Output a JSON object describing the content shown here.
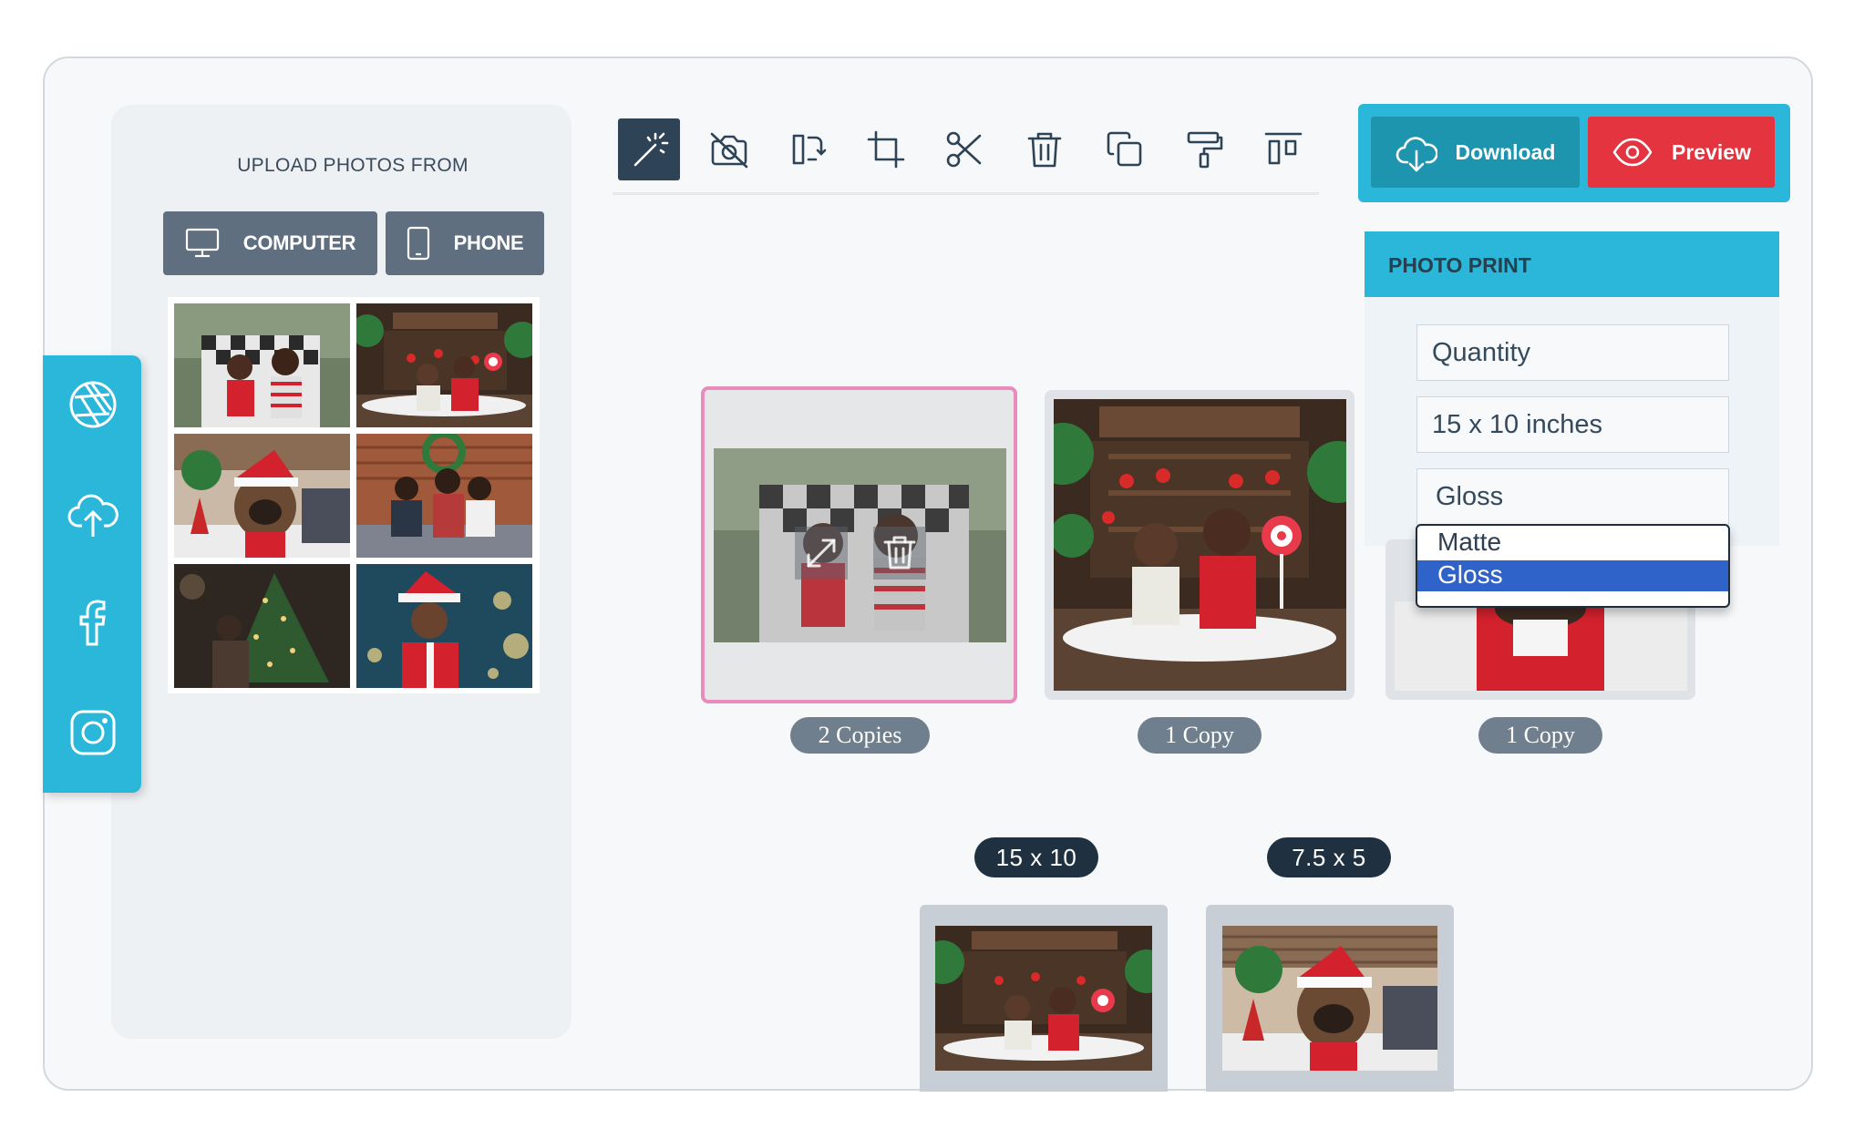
{
  "upload": {
    "title": "UPLOAD PHOTOS FROM",
    "computer_label": "COMPUTER",
    "phone_label": "PHONE"
  },
  "social": {
    "items": [
      "aperture-icon",
      "cloud-upload-icon",
      "facebook-icon",
      "instagram-icon"
    ]
  },
  "toolbar": {
    "tools": [
      "magic-wand-icon",
      "no-camera-icon",
      "rotate-icon",
      "crop-icon",
      "cut-icon",
      "trash-icon",
      "duplicate-icon",
      "paint-roller-icon",
      "layout-icon"
    ]
  },
  "actions": {
    "download_label": "Download",
    "preview_label": "Preview"
  },
  "photo_print": {
    "header": "PHOTO PRINT",
    "quantity_placeholder": "Quantity",
    "size_value": "15 x 10 inches",
    "finish_value": "Gloss",
    "finish_options": [
      "Matte",
      "Gloss"
    ],
    "selected_option": "Gloss"
  },
  "cards": [
    {
      "copies": "2 Copies"
    },
    {
      "copies": "1 Copy"
    },
    {
      "copies": "1 Copy"
    }
  ],
  "sizes": [
    {
      "label": "15 x 10"
    },
    {
      "label": "7.5 x 5"
    }
  ],
  "colors": {
    "accent": "#2ab7d9",
    "preview_red": "#e3343f",
    "dark_navy": "#2f4356",
    "selected_border": "#e98bbd"
  }
}
